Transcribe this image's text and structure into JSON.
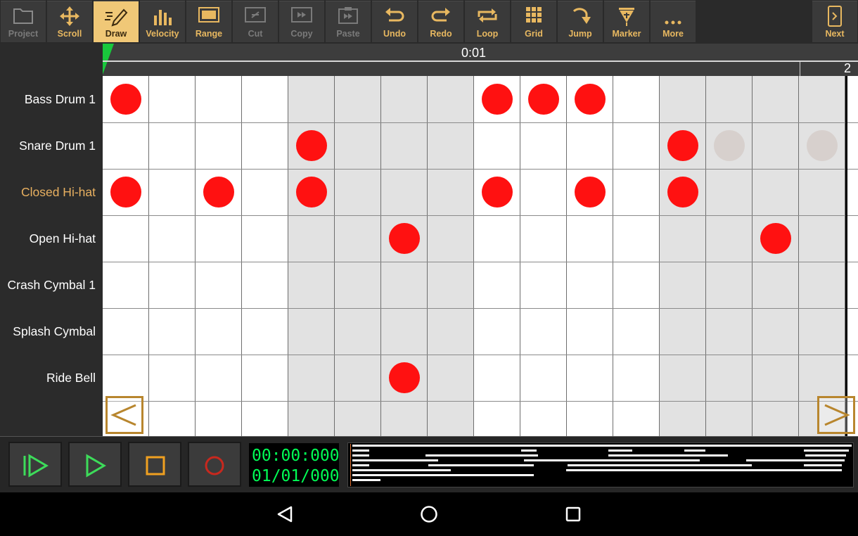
{
  "toolbar": {
    "project": "Project",
    "scroll": "Scroll",
    "draw": "Draw",
    "velocity": "Velocity",
    "range": "Range",
    "cut": "Cut",
    "copy": "Copy",
    "paste": "Paste",
    "undo": "Undo",
    "redo": "Redo",
    "loop": "Loop",
    "grid": "Grid",
    "jump": "Jump",
    "marker": "Marker",
    "more": "More",
    "next": "Next"
  },
  "ruler": {
    "time": "0:01",
    "bar": "2"
  },
  "drums": [
    "Bass Drum 1",
    "Snare Drum 1",
    "Closed Hi-hat",
    "Open Hi-hat",
    "Crash Cymbal 1",
    "Splash Cymbal",
    "Ride Bell"
  ],
  "selected_drum": "Closed Hi-hat",
  "pattern": {
    "steps": 16,
    "notes": [
      {
        "row": 0,
        "steps": [
          0,
          8,
          9,
          10
        ]
      },
      {
        "row": 1,
        "steps": [
          4,
          12
        ]
      },
      {
        "row": 2,
        "steps": [
          0,
          2,
          4,
          8,
          10,
          12
        ]
      },
      {
        "row": 3,
        "steps": [
          6,
          14
        ]
      },
      {
        "row": 6,
        "steps": [
          6
        ]
      }
    ],
    "ghost_notes": [
      {
        "row": 1,
        "steps": [
          13,
          15
        ]
      }
    ]
  },
  "transport": {
    "time": "00:00:000",
    "position": "01/01/000"
  },
  "colors": {
    "accent": "#e8b860",
    "note": "#ff1111",
    "display_text": "#00ff55"
  }
}
